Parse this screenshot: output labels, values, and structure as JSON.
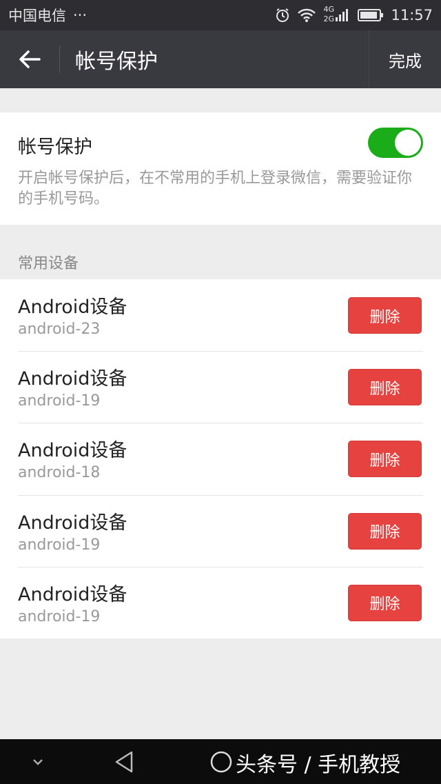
{
  "status_bar": {
    "carrier": "中国电信",
    "more": "···",
    "network_4g": "4G",
    "network_2g": "2G",
    "time": "11:57"
  },
  "nav": {
    "title": "帐号保护",
    "done_label": "完成"
  },
  "protection": {
    "title": "帐号保护",
    "enabled": true,
    "toggle_color": "#1aad19",
    "description": "开启帐号保护后，在不常用的手机上登录微信，需要验证你的手机号码。"
  },
  "devices_section": {
    "label": "常用设备",
    "items": [
      {
        "name": "Android设备",
        "id": "android-23",
        "delete_label": "删除"
      },
      {
        "name": "Android设备",
        "id": "android-19",
        "delete_label": "删除"
      },
      {
        "name": "Android设备",
        "id": "android-18",
        "delete_label": "删除"
      },
      {
        "name": "Android设备",
        "id": "android-19",
        "delete_label": "删除"
      },
      {
        "name": "Android设备",
        "id": "android-19",
        "delete_label": "删除"
      }
    ],
    "delete_color": "#e64340"
  },
  "watermark": {
    "text": "头条号 / 手机教授"
  }
}
